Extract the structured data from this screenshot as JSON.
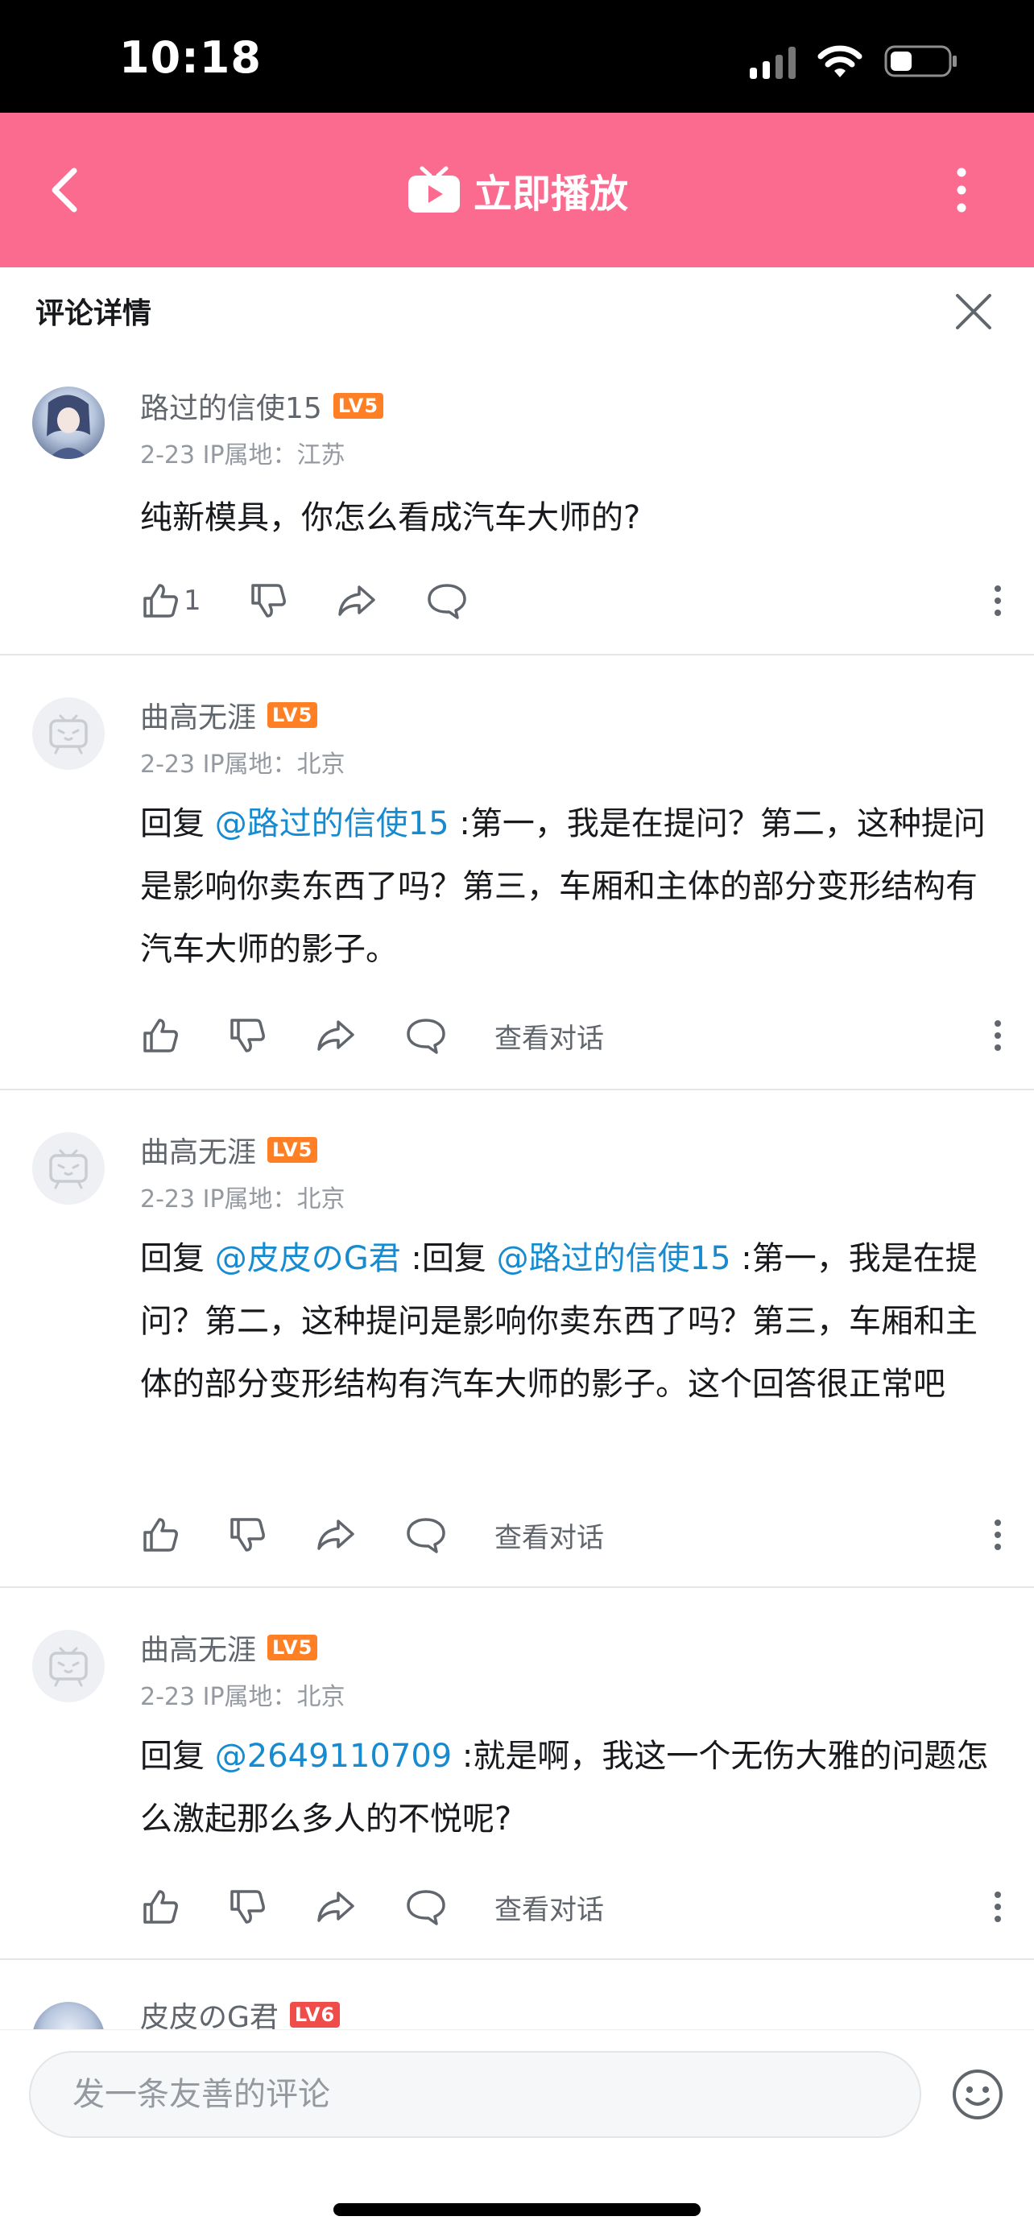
{
  "status_bar": {
    "time": "10:18"
  },
  "top_bar": {
    "title": "立即播放"
  },
  "panel": {
    "title": "评论详情"
  },
  "comments": [
    {
      "username": "路过的信使15",
      "level": "LV5",
      "meta": "2-23  IP属地：江苏",
      "body": "纯新模具，你怎么看成汽车大师的?",
      "likes": "1"
    },
    {
      "username": "曲高无涯",
      "level": "LV5",
      "meta": "2-23  IP属地：北京",
      "reply_prefix": "回复 ",
      "mention1": "@路过的信使15",
      "body": " :第一，我是在提问？第二，这种提问是影响你卖东西了吗？第三，车厢和主体的部分变形结构有汽车大师的影子。",
      "view_conversation": "查看对话"
    },
    {
      "username": "曲高无涯",
      "level": "LV5",
      "meta": "2-23  IP属地：北京",
      "reply_prefix": "回复 ",
      "mention1": "@皮皮のG君",
      "mid": " :回复 ",
      "mention2": "@路过的信使15",
      "body": " :第一，我是在提问？第二，这种提问是影响你卖东西了吗？第三，车厢和主体的部分变形结构有汽车大师的影子。这个回答很正常吧",
      "view_conversation": "查看对话"
    },
    {
      "username": "曲高无涯",
      "level": "LV5",
      "meta": "2-23  IP属地：北京",
      "reply_prefix": "回复 ",
      "mention1": "@2649110709",
      "body": " :就是啊，我这一个无伤大雅的问题怎么激起那么多人的不悦呢?",
      "view_conversation": "查看对话"
    },
    {
      "username": "皮皮のG君",
      "level": "LV6"
    }
  ],
  "input": {
    "placeholder": "发一条友善的评论"
  },
  "colors": {
    "brand_pink": "#fb6a8f",
    "mention_blue": "#178bcf",
    "level5": "#ff7f24",
    "level6": "#f04c49"
  },
  "icons": [
    "back-arrow-icon",
    "tv-icon",
    "more-vertical-icon",
    "close-icon",
    "thumb-up-icon",
    "thumb-down-icon",
    "share-icon",
    "reply-icon",
    "emoji-icon"
  ]
}
